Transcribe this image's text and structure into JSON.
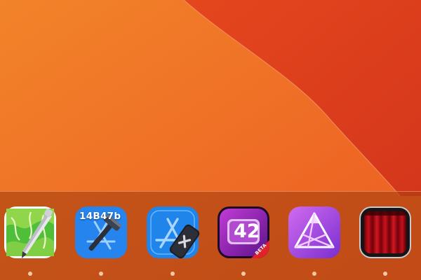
{
  "dock": {
    "items": [
      {
        "name": "cotEditor",
        "icon": "pen-on-map-icon",
        "running": true
      },
      {
        "name": "xcode",
        "icon": "hammer-blueprint-icon",
        "running": true,
        "badge": "14B47b"
      },
      {
        "name": "xcode-cleaner",
        "icon": "appstore-cleaner-icon",
        "running": true
      },
      {
        "name": "42-countdown",
        "icon": "number-42-icon",
        "running": true,
        "label": "42",
        "ribbon": "BETA"
      },
      {
        "name": "affinity-photo",
        "icon": "aperture-triangle-icon",
        "running": true
      },
      {
        "name": "red-curtain",
        "icon": "red-curtain-icon",
        "running": true
      }
    ]
  },
  "colors": {
    "wallpaper_light": "#f07a26",
    "wallpaper_dark": "#d83a1e",
    "dock_tint": "#a84010",
    "running_dot": "#f6c9a6"
  }
}
